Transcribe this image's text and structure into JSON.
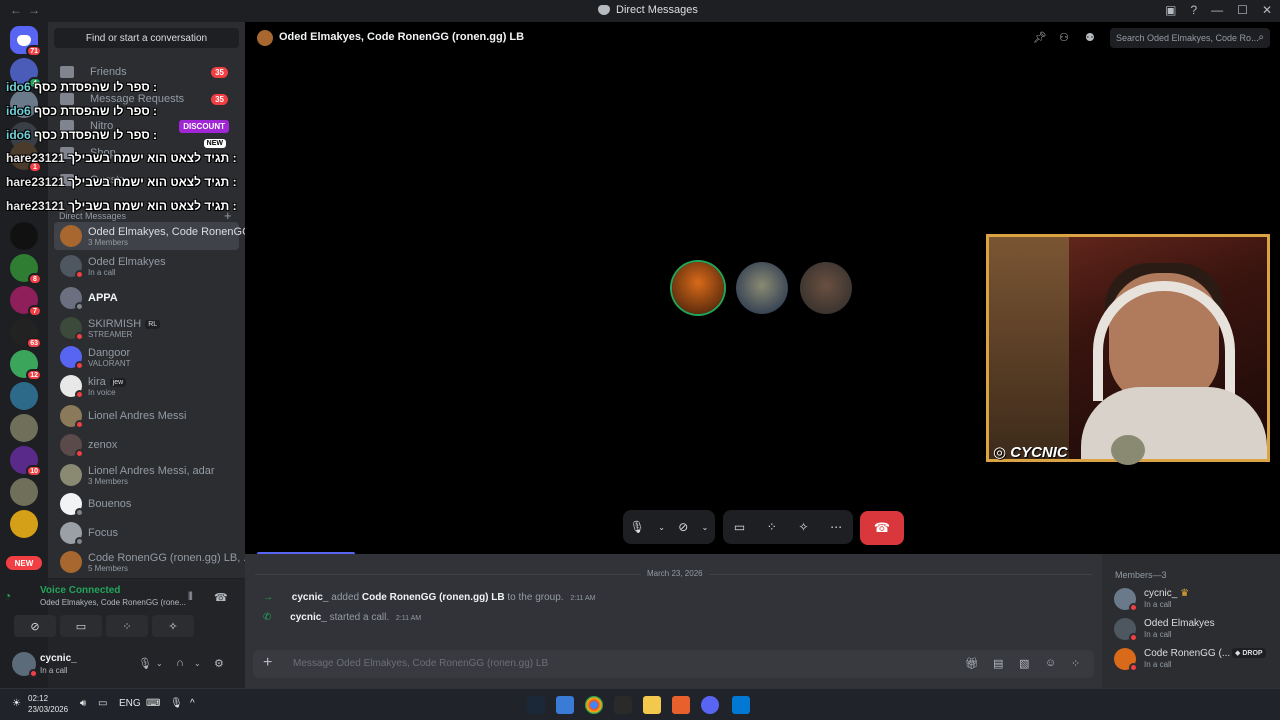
{
  "window": {
    "title": "Direct Messages"
  },
  "rail": {
    "badges": [
      "71",
      "4",
      "1",
      "8",
      "7",
      "63",
      "12",
      "10"
    ],
    "new_label": "NEW"
  },
  "sidebar": {
    "find_placeholder": "Find or start a conversation",
    "nav": [
      {
        "label": "Friends",
        "count": "35"
      },
      {
        "label": "Message Requests",
        "count": "35"
      },
      {
        "label": "Nitro",
        "badge": "DISCOUNT"
      },
      {
        "label": "Shop",
        "badge": "NEW"
      },
      {
        "label": "Quests"
      }
    ],
    "dm_header": "Direct Messages",
    "dms": [
      {
        "name": "Oded Elmakyes, Code RonenGG...",
        "sub": "3 Members"
      },
      {
        "name": "Oded Elmakyes",
        "sub": "In a call"
      },
      {
        "name": "APPA"
      },
      {
        "name": "SKIRMISH",
        "tag": "RL",
        "sub": "STREAMER"
      },
      {
        "name": "Dangoor",
        "sub": "VALORANT"
      },
      {
        "name": "kira",
        "tag": "jew",
        "sub": "In voice"
      },
      {
        "name": "Lionel Andres Messi"
      },
      {
        "name": "zenox"
      },
      {
        "name": "Lionel Andres Messi, adar",
        "sub": "3 Members"
      },
      {
        "name": "Bouenos"
      },
      {
        "name": "Focus"
      },
      {
        "name": "Code RonenGG (ronen.gg) LB, ...",
        "sub": "5 Members"
      }
    ]
  },
  "voice": {
    "status": "Voice Connected",
    "channel": "Oded Elmakyes, Code RonenGG (rone..."
  },
  "user": {
    "name": "cycnic_",
    "status": "In a call"
  },
  "topbar": {
    "title": "Oded Elmakyes, Code RonenGG (ronen.gg) LB",
    "search_placeholder": "Search Oded Elmakyes, Code Ro..."
  },
  "webcam": {
    "handle": "CYCNIC"
  },
  "chat": {
    "date": "March 23, 2026",
    "messages": [
      {
        "user": "cycnic_",
        "action": "added",
        "target": "Code RonenGG (ronen.gg) LB",
        "suffix": "to the group.",
        "time": "2:11 AM"
      },
      {
        "user": "cycnic_",
        "action": "started a call.",
        "time": "2:11 AM"
      }
    ],
    "composer_placeholder": "Message Oded Elmakyes, Code RonenGG (ronen.gg) LB"
  },
  "members": {
    "header": "Members—3",
    "list": [
      {
        "name": "cycnic_",
        "status": "In a call"
      },
      {
        "name": "Oded Elmakyes",
        "status": "In a call"
      },
      {
        "name": "Code RonenGG (...",
        "status": "In a call",
        "tag": "DROP"
      }
    ]
  },
  "overlay_chat": [
    {
      "user": "ido6",
      "text": "ספר לו שהפסדת כסף :"
    },
    {
      "user": "ido6",
      "text": "ספר לו שהפסדת כסף :"
    },
    {
      "user": "ido6",
      "text": "ספר לו שהפסדת כסף :"
    },
    {
      "user": "hare23121",
      "text": "תגיד לצאט הוא ישמח בשבילך :"
    },
    {
      "user": "hare23121",
      "text": "תגיד לצאט הוא ישמח בשבילך :"
    },
    {
      "user": "hare23121",
      "text": "תגיד לצאט הוא ישמח בשבילך :"
    }
  ],
  "taskbar": {
    "time": "02:12",
    "date": "23/03/2026",
    "lang": "ENG"
  },
  "colors": {
    "accent": "#5865f2",
    "danger": "#da373c",
    "online": "#23a55a"
  }
}
